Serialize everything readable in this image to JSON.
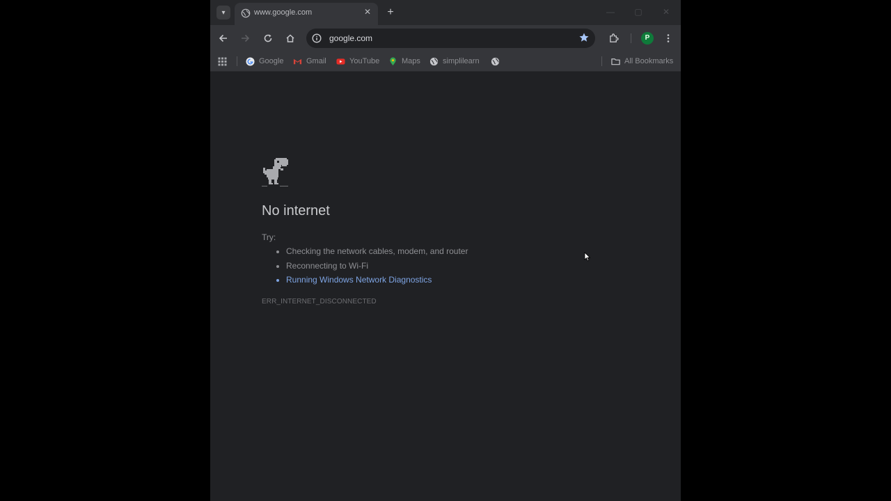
{
  "tab": {
    "title": "www.google.com",
    "close_symbol": "✕",
    "new_tab_symbol": "+",
    "tab_search_symbol": "▾"
  },
  "window_controls": {
    "minimize": "—",
    "maximize": "▢",
    "close": "✕"
  },
  "toolbar": {
    "url": "google.com",
    "profile_initial": "P"
  },
  "bookmarks": {
    "items": [
      {
        "label": "Google",
        "icon": "google-icon"
      },
      {
        "label": "Gmail",
        "icon": "gmail-icon"
      },
      {
        "label": "YouTube",
        "icon": "youtube-icon"
      },
      {
        "label": "Maps",
        "icon": "maps-icon"
      },
      {
        "label": "simplilearn",
        "icon": "globe-icon"
      },
      {
        "label": "",
        "icon": "globe-icon"
      }
    ],
    "all_bookmarks": "All Bookmarks"
  },
  "error_page": {
    "title": "No internet",
    "try_label": "Try:",
    "suggestions": [
      "Checking the network cables, modem, and router",
      "Reconnecting to Wi-Fi",
      "Running Windows Network Diagnostics"
    ],
    "error_code": "ERR_INTERNET_DISCONNECTED"
  },
  "colors": {
    "page_bg": "#202124",
    "toolbar_bg": "#35363a",
    "tabstrip_bg": "#28292c",
    "link": "#7ea4e3",
    "profile": "#0f7a3a",
    "star": "#a8c7fa"
  }
}
